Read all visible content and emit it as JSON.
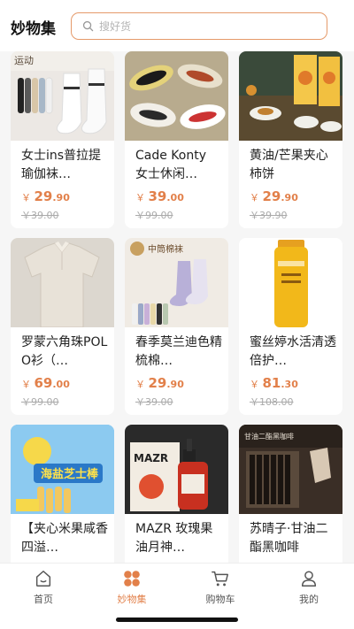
{
  "header": {
    "title": "妙物集",
    "search_placeholder": "搜好货"
  },
  "products": [
    {
      "title": "女士ins普拉提瑜伽袜…",
      "price_int": "29",
      "price_dec": ".90",
      "currency": "￥",
      "orig": "￥39.00",
      "badge": "运动"
    },
    {
      "title": "Cade Konty 女士休闲…",
      "price_int": "39",
      "price_dec": ".00",
      "currency": "￥",
      "orig": "￥99.00"
    },
    {
      "title": "黄油/芒果夹心柿饼",
      "price_int": "29",
      "price_dec": ".90",
      "currency": "￥",
      "orig": "￥39.90"
    },
    {
      "title": "罗蒙六角珠POLO衫（…",
      "price_int": "69",
      "price_dec": ".00",
      "currency": "￥",
      "orig": "￥99.00"
    },
    {
      "title": "春季莫兰迪色精梳棉…",
      "price_int": "29",
      "price_dec": ".90",
      "currency": "￥",
      "orig": "￥39.00",
      "badge": "中筒棉袜"
    },
    {
      "title": "蜜丝婷水活清透倍护…",
      "price_int": "81",
      "price_dec": ".30",
      "currency": "￥",
      "orig": "￥108.00"
    },
    {
      "title": "【夹心米果咸香四溢…",
      "badge": "海盐芝士棒"
    },
    {
      "title": "MAZR 玫瑰果油月神…",
      "badge": "MAZR"
    },
    {
      "title": "苏晴子·甘油二酯黑咖啡",
      "badge": "甘油二酯黑咖啡"
    }
  ],
  "tabbar": {
    "items": [
      {
        "label": "首页",
        "icon": "home-icon",
        "active": false
      },
      {
        "label": "妙物集",
        "icon": "grid-icon",
        "active": true
      },
      {
        "label": "购物车",
        "icon": "cart-icon",
        "active": false
      },
      {
        "label": "我的",
        "icon": "user-icon",
        "active": false
      }
    ]
  },
  "colors": {
    "accent": "#e2804a",
    "search_border": "#e59a6a",
    "background": "#f6f6f6"
  }
}
